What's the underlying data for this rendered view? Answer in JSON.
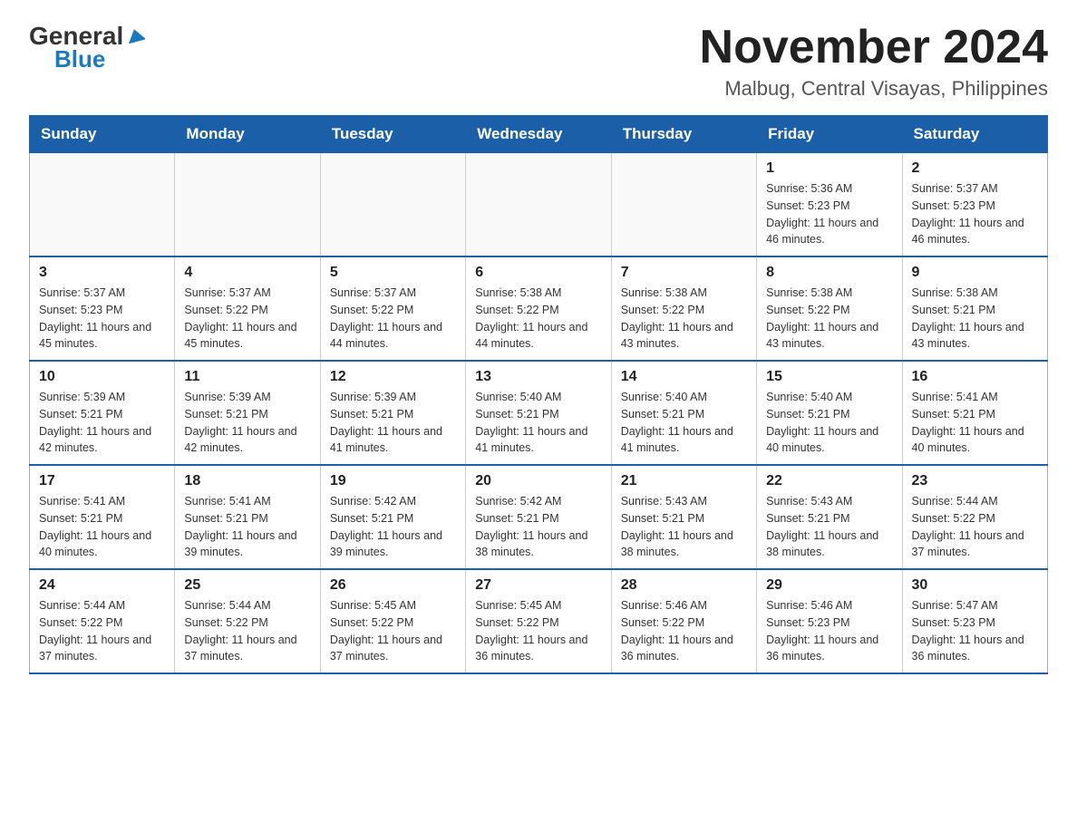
{
  "header": {
    "logo_general": "General",
    "logo_blue": "Blue",
    "title": "November 2024",
    "subtitle": "Malbug, Central Visayas, Philippines"
  },
  "calendar": {
    "days_of_week": [
      "Sunday",
      "Monday",
      "Tuesday",
      "Wednesday",
      "Thursday",
      "Friday",
      "Saturday"
    ],
    "weeks": [
      [
        {
          "day": "",
          "info": ""
        },
        {
          "day": "",
          "info": ""
        },
        {
          "day": "",
          "info": ""
        },
        {
          "day": "",
          "info": ""
        },
        {
          "day": "",
          "info": ""
        },
        {
          "day": "1",
          "info": "Sunrise: 5:36 AM\nSunset: 5:23 PM\nDaylight: 11 hours and 46 minutes."
        },
        {
          "day": "2",
          "info": "Sunrise: 5:37 AM\nSunset: 5:23 PM\nDaylight: 11 hours and 46 minutes."
        }
      ],
      [
        {
          "day": "3",
          "info": "Sunrise: 5:37 AM\nSunset: 5:23 PM\nDaylight: 11 hours and 45 minutes."
        },
        {
          "day": "4",
          "info": "Sunrise: 5:37 AM\nSunset: 5:22 PM\nDaylight: 11 hours and 45 minutes."
        },
        {
          "day": "5",
          "info": "Sunrise: 5:37 AM\nSunset: 5:22 PM\nDaylight: 11 hours and 44 minutes."
        },
        {
          "day": "6",
          "info": "Sunrise: 5:38 AM\nSunset: 5:22 PM\nDaylight: 11 hours and 44 minutes."
        },
        {
          "day": "7",
          "info": "Sunrise: 5:38 AM\nSunset: 5:22 PM\nDaylight: 11 hours and 43 minutes."
        },
        {
          "day": "8",
          "info": "Sunrise: 5:38 AM\nSunset: 5:22 PM\nDaylight: 11 hours and 43 minutes."
        },
        {
          "day": "9",
          "info": "Sunrise: 5:38 AM\nSunset: 5:21 PM\nDaylight: 11 hours and 43 minutes."
        }
      ],
      [
        {
          "day": "10",
          "info": "Sunrise: 5:39 AM\nSunset: 5:21 PM\nDaylight: 11 hours and 42 minutes."
        },
        {
          "day": "11",
          "info": "Sunrise: 5:39 AM\nSunset: 5:21 PM\nDaylight: 11 hours and 42 minutes."
        },
        {
          "day": "12",
          "info": "Sunrise: 5:39 AM\nSunset: 5:21 PM\nDaylight: 11 hours and 41 minutes."
        },
        {
          "day": "13",
          "info": "Sunrise: 5:40 AM\nSunset: 5:21 PM\nDaylight: 11 hours and 41 minutes."
        },
        {
          "day": "14",
          "info": "Sunrise: 5:40 AM\nSunset: 5:21 PM\nDaylight: 11 hours and 41 minutes."
        },
        {
          "day": "15",
          "info": "Sunrise: 5:40 AM\nSunset: 5:21 PM\nDaylight: 11 hours and 40 minutes."
        },
        {
          "day": "16",
          "info": "Sunrise: 5:41 AM\nSunset: 5:21 PM\nDaylight: 11 hours and 40 minutes."
        }
      ],
      [
        {
          "day": "17",
          "info": "Sunrise: 5:41 AM\nSunset: 5:21 PM\nDaylight: 11 hours and 40 minutes."
        },
        {
          "day": "18",
          "info": "Sunrise: 5:41 AM\nSunset: 5:21 PM\nDaylight: 11 hours and 39 minutes."
        },
        {
          "day": "19",
          "info": "Sunrise: 5:42 AM\nSunset: 5:21 PM\nDaylight: 11 hours and 39 minutes."
        },
        {
          "day": "20",
          "info": "Sunrise: 5:42 AM\nSunset: 5:21 PM\nDaylight: 11 hours and 38 minutes."
        },
        {
          "day": "21",
          "info": "Sunrise: 5:43 AM\nSunset: 5:21 PM\nDaylight: 11 hours and 38 minutes."
        },
        {
          "day": "22",
          "info": "Sunrise: 5:43 AM\nSunset: 5:21 PM\nDaylight: 11 hours and 38 minutes."
        },
        {
          "day": "23",
          "info": "Sunrise: 5:44 AM\nSunset: 5:22 PM\nDaylight: 11 hours and 37 minutes."
        }
      ],
      [
        {
          "day": "24",
          "info": "Sunrise: 5:44 AM\nSunset: 5:22 PM\nDaylight: 11 hours and 37 minutes."
        },
        {
          "day": "25",
          "info": "Sunrise: 5:44 AM\nSunset: 5:22 PM\nDaylight: 11 hours and 37 minutes."
        },
        {
          "day": "26",
          "info": "Sunrise: 5:45 AM\nSunset: 5:22 PM\nDaylight: 11 hours and 37 minutes."
        },
        {
          "day": "27",
          "info": "Sunrise: 5:45 AM\nSunset: 5:22 PM\nDaylight: 11 hours and 36 minutes."
        },
        {
          "day": "28",
          "info": "Sunrise: 5:46 AM\nSunset: 5:22 PM\nDaylight: 11 hours and 36 minutes."
        },
        {
          "day": "29",
          "info": "Sunrise: 5:46 AM\nSunset: 5:23 PM\nDaylight: 11 hours and 36 minutes."
        },
        {
          "day": "30",
          "info": "Sunrise: 5:47 AM\nSunset: 5:23 PM\nDaylight: 11 hours and 36 minutes."
        }
      ]
    ]
  }
}
